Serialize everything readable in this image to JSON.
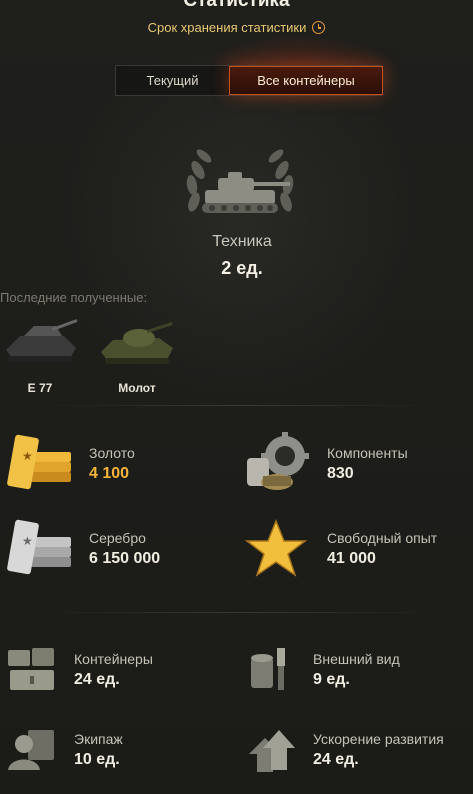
{
  "header": {
    "title": "Статистика",
    "subtitle": "Срок хранения статистики"
  },
  "tabs": [
    {
      "label": "Текущий",
      "active": false
    },
    {
      "label": "Все контейнеры",
      "active": true
    }
  ],
  "hero": {
    "label": "Техника",
    "value": "2 ед."
  },
  "recent": {
    "label": "Последние полученные:",
    "items": [
      {
        "name": "E 77"
      },
      {
        "name": "Молот"
      }
    ]
  },
  "stats": {
    "gold": {
      "label": "Золото",
      "value": "4 100"
    },
    "components": {
      "label": "Компоненты",
      "value": "830"
    },
    "silver": {
      "label": "Серебро",
      "value": "6 150 000"
    },
    "free_xp": {
      "label": "Свободный опыт",
      "value": "41 000"
    },
    "containers": {
      "label": "Контейнеры",
      "value": "24 ед."
    },
    "customization": {
      "label": "Внешний вид",
      "value": "9 ед."
    },
    "crew": {
      "label": "Экипаж",
      "value": "10 ед."
    },
    "boosters": {
      "label": "Ускорение развития",
      "value": "24 ед."
    }
  },
  "colors": {
    "accent": "#c0541f",
    "gold": "#f4b53a",
    "subtitle": "#e8c770"
  }
}
